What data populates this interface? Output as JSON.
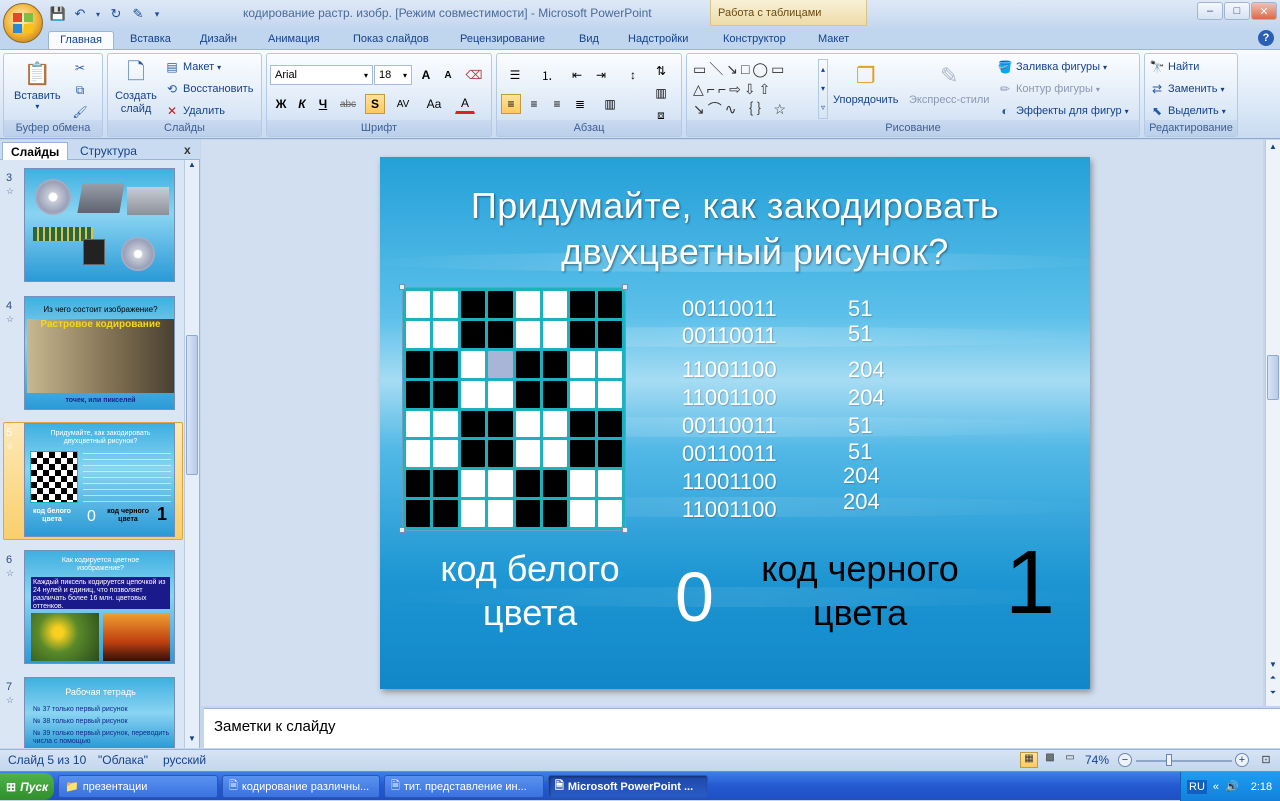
{
  "window": {
    "title": "кодирование растр. изобр. [Режим совместимости] - Microsoft PowerPoint",
    "context_tab": "Работа с таблицами",
    "controls": {
      "minimize": "–",
      "maximize": "□",
      "close": "✕"
    }
  },
  "ribbon_tabs": [
    "Главная",
    "Вставка",
    "Дизайн",
    "Анимация",
    "Показ слайдов",
    "Рецензирование",
    "Вид",
    "Надстройки",
    "Конструктор",
    "Макет"
  ],
  "ribbon": {
    "clipboard": {
      "label": "Буфер обмена",
      "paste": "Вставить"
    },
    "slides": {
      "label": "Слайды",
      "new_slide": "Создать слайд",
      "layout": "Макет",
      "reset": "Восстановить",
      "delete": "Удалить"
    },
    "font": {
      "label": "Шрифт",
      "font_name": "Arial",
      "font_size": "18",
      "bold": "Ж",
      "italic": "К",
      "underline": "Ч",
      "strike": "abc",
      "shadow": "S",
      "spacing": "AV",
      "case": "Aa",
      "color": "A",
      "grow": "A",
      "shrink": "A"
    },
    "paragraph": {
      "label": "Абзац"
    },
    "drawing": {
      "label": "Рисование",
      "arrange": "Упорядочить",
      "quick_styles": "Экспресс-стили",
      "fill": "Заливка фигуры",
      "outline": "Контур фигуры",
      "effects": "Эффекты для фигур"
    },
    "editing": {
      "label": "Редактирование",
      "find": "Найти",
      "replace": "Заменить",
      "select": "Выделить"
    }
  },
  "left_panel": {
    "tabs": [
      "Слайды",
      "Структура"
    ],
    "close": "x",
    "thumbnails": [
      {
        "num": "3",
        "title": ""
      },
      {
        "num": "4",
        "title": "Из чего состоит изображение?",
        "subtitle": "Растровое кодирование",
        "footer": "точек, или пикселей"
      },
      {
        "num": "5",
        "title": "Придумайте, как закодировать двухцветный рисунок?",
        "white": "код белого цвета",
        "zero": "0",
        "black": "код черного цвета",
        "one": "1"
      },
      {
        "num": "6",
        "title": "Как кодируется цветное изображение?",
        "text": "Каждый пиксель кодируется цепочкой из 24 нулей и единиц, что позволяет различать более 16 млн. цветовых оттенков."
      },
      {
        "num": "7",
        "title": "Рабочая тетрадь",
        "items": [
          "№ 37 только первый рисунок",
          "№ 38 только первый рисунок",
          "№ 39 только первый рисунок, переводить числа с помощью"
        ]
      }
    ]
  },
  "slide": {
    "title_line1": "Придумайте, как закодировать",
    "title_line2": "двухцветный рисунок?",
    "grid": [
      [
        "w",
        "w",
        "b",
        "b",
        "w",
        "w",
        "b",
        "b"
      ],
      [
        "w",
        "w",
        "b",
        "b",
        "w",
        "w",
        "b",
        "b"
      ],
      [
        "b",
        "b",
        "w",
        "s",
        "b",
        "b",
        "w",
        "w"
      ],
      [
        "b",
        "b",
        "w",
        "w",
        "b",
        "b",
        "w",
        "w"
      ],
      [
        "w",
        "w",
        "b",
        "b",
        "w",
        "w",
        "b",
        "b"
      ],
      [
        "w",
        "w",
        "b",
        "b",
        "w",
        "w",
        "b",
        "b"
      ],
      [
        "b",
        "b",
        "w",
        "w",
        "b",
        "b",
        "w",
        "w"
      ],
      [
        "b",
        "b",
        "w",
        "w",
        "b",
        "b",
        "w",
        "w"
      ]
    ],
    "binary": [
      "00110011",
      "00110011",
      "11001100",
      "11001100",
      "00110011",
      "00110011",
      "11001100",
      "11001100"
    ],
    "decimal": [
      "51",
      "51",
      "204",
      "204",
      "51",
      "51",
      "204",
      "204"
    ],
    "white_label_1": "код белого",
    "white_label_2": "цвета",
    "zero": "0",
    "black_label_1": "код черного",
    "black_label_2": "цвета",
    "one": "1"
  },
  "notes_placeholder": "Заметки к слайду",
  "status": {
    "slide": "Слайд 5 из 10",
    "theme": "\"Облака\"",
    "language": "русский",
    "zoom": "74%"
  },
  "taskbar": {
    "start": "Пуск",
    "items": [
      "презентации",
      "кодирование различны...",
      "тит. представление ин...",
      "Microsoft PowerPoint ..."
    ],
    "lang": "RU",
    "time": "2:18"
  }
}
